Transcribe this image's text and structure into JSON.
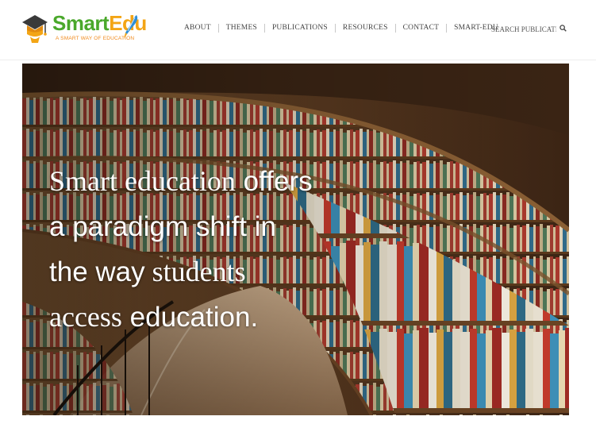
{
  "brand": {
    "name_part1": "Smart",
    "name_part2": "Edu",
    "tagline": "A SMART WAY OF EDUCATION",
    "colors": {
      "green": "#4aa82b",
      "orange": "#f3a515"
    },
    "icons": [
      "graduation-cap-icon",
      "pen-icon"
    ]
  },
  "nav": {
    "items": [
      {
        "label": "ABOUT"
      },
      {
        "label": "THEMES"
      },
      {
        "label": "PUBLICATIONS"
      },
      {
        "label": "RESOURCES"
      },
      {
        "label": "CONTACT"
      },
      {
        "label": "SMART-EDU"
      }
    ]
  },
  "search": {
    "placeholder": "SEARCH PUBLICATIONS",
    "icon": "search-icon"
  },
  "hero": {
    "line1_serif": "Smart education",
    "line1_sans": " offers",
    "line2_sans": "a paradigm shift in",
    "line3_sans": "the way",
    "line3_serif": " students",
    "line4_serif": "access",
    "line4_sans": " education."
  }
}
